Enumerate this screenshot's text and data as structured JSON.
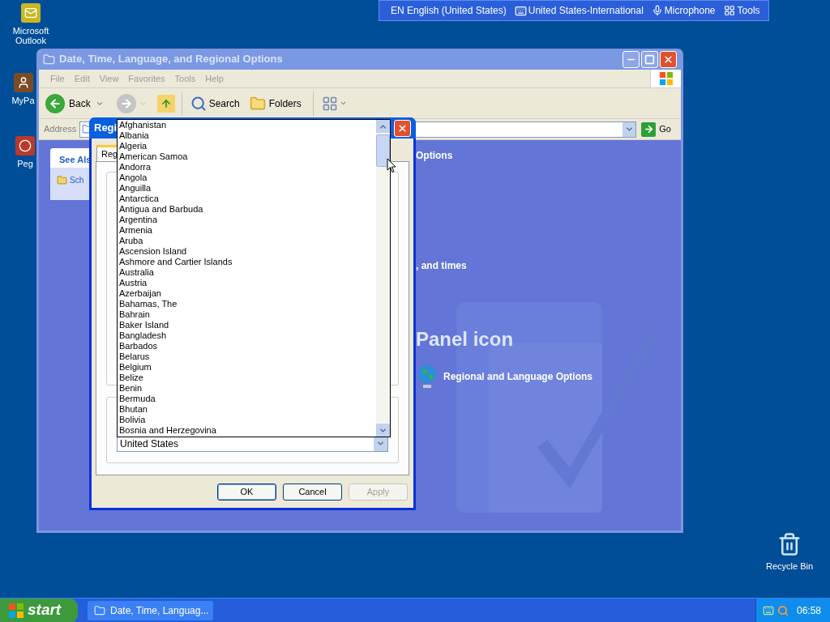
{
  "desktop_icons": [
    {
      "label": "Microsoft Outlook"
    },
    {
      "label": "MyPa"
    },
    {
      "label": "Peg"
    }
  ],
  "recycle_bin": {
    "label": "Recycle Bin"
  },
  "language_bar": {
    "language": "EN English (United States)",
    "keyboard": "United States-International",
    "microphone": "Microphone",
    "tools": "Tools"
  },
  "explorer": {
    "title": "Date, Time, Language, and Regional Options",
    "active": false,
    "menu": [
      "File",
      "Edit",
      "View",
      "Favorites",
      "Tools",
      "Help"
    ],
    "toolbar": {
      "back": "Back",
      "search": "Search",
      "folders": "Folders"
    },
    "address": {
      "label": "Address",
      "go": "Go"
    },
    "sidebar": {
      "heading": "See Als",
      "items": [
        "Sch"
      ]
    },
    "content": {
      "heading": "Options",
      "task": ", and times",
      "subheading": "Panel icon",
      "items": [
        "Regional and Language Options"
      ]
    }
  },
  "dialog": {
    "title": "Regi",
    "active": true,
    "tabs": [
      {
        "label": "Reg",
        "selected": true
      }
    ],
    "dropdown": {
      "expanded": true,
      "value": "United States",
      "options": [
        "Afghanistan",
        "Albania",
        "Algeria",
        "American Samoa",
        "Andorra",
        "Angola",
        "Anguilla",
        "Antarctica",
        "Antigua and Barbuda",
        "Argentina",
        "Armenia",
        "Aruba",
        "Ascension Island",
        "Ashmore and Cartier Islands",
        "Australia",
        "Austria",
        "Azerbaijan",
        "Bahamas, The",
        "Bahrain",
        "Baker Island",
        "Bangladesh",
        "Barbados",
        "Belarus",
        "Belgium",
        "Belize",
        "Benin",
        "Bermuda",
        "Bhutan",
        "Bolivia",
        "Bosnia and Herzegovina"
      ]
    },
    "buttons": [
      {
        "label": "OK",
        "disabled": false
      },
      {
        "label": "Cancel",
        "disabled": false
      },
      {
        "label": "Apply",
        "disabled": true
      }
    ]
  },
  "taskbar": {
    "start": "start",
    "tasks": [
      {
        "label": "Date, Time, Languag..."
      }
    ],
    "clock": "06:58"
  }
}
